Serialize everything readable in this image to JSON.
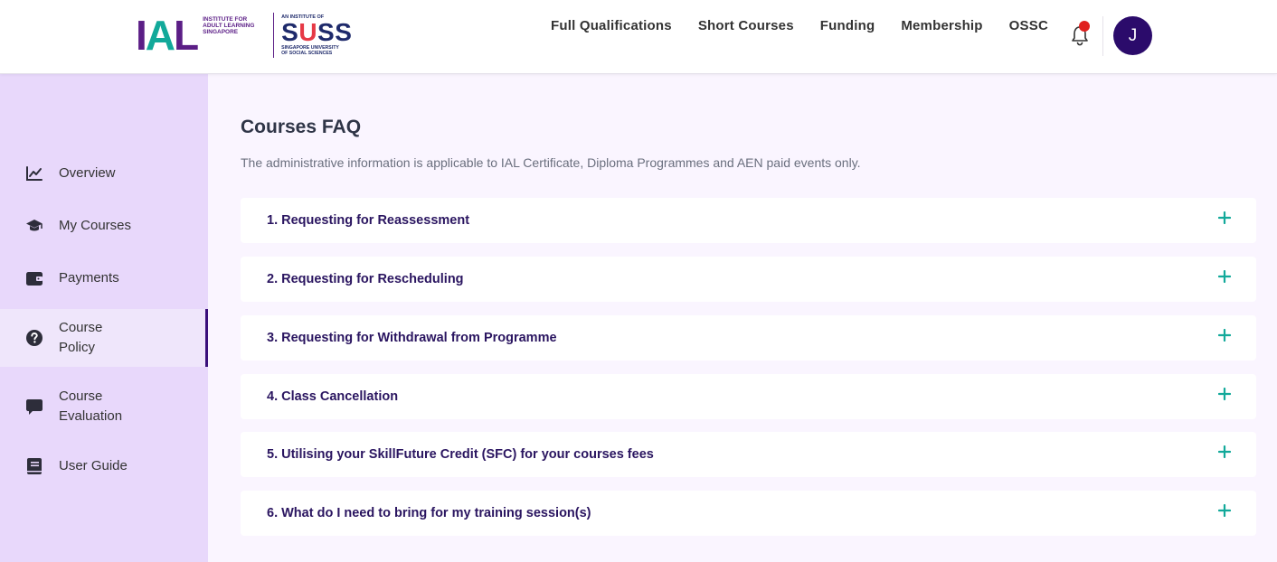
{
  "brand": {
    "ial_letters": [
      "I",
      "A",
      "L"
    ],
    "ial_subtitle": [
      "INSTITUTE FOR",
      "ADULT LEARNING",
      "SINGAPORE"
    ],
    "suss_pre": "AN INSTITUTE OF",
    "suss_name_parts": [
      "S",
      "U",
      "S",
      "S"
    ],
    "suss_subtitle": [
      "SINGAPORE UNIVERSITY",
      "OF SOCIAL SCIENCES"
    ],
    "colors": {
      "purple": "#5b1e86",
      "teal": "#12a99a",
      "navy": "#1e2a6b",
      "red": "#e63946"
    }
  },
  "nav": {
    "links": [
      "Full Qualifications",
      "Short Courses",
      "Funding",
      "Membership",
      "OSSC"
    ]
  },
  "header": {
    "bell_icon": "bell-icon",
    "notification_dot_color": "#e0201e",
    "avatar_initial": "J",
    "avatar_color": "#2b0b6b"
  },
  "sidebar": {
    "items": [
      {
        "label": "Overview",
        "icon": "chart-line-icon"
      },
      {
        "label": "My Courses",
        "icon": "graduation-cap-icon"
      },
      {
        "label": "Payments",
        "icon": "wallet-icon"
      },
      {
        "label": "Course Policy",
        "label_lines": [
          "Course",
          "Policy"
        ],
        "icon": "question-circle-icon",
        "active": true
      },
      {
        "label": "Course Evaluation",
        "label_lines": [
          "Course",
          "Evaluation"
        ],
        "icon": "comment-icon"
      },
      {
        "label": "User Guide",
        "icon": "book-icon"
      }
    ],
    "active_color": "#3a0f7a"
  },
  "main": {
    "title": "Courses FAQ",
    "description": "The administrative information is applicable to IAL Certificate, Diploma Programmes and AEN paid events only.",
    "faqs": [
      "1. Requesting for Reassessment",
      "2. Requesting for Rescheduling",
      "3. Requesting for Withdrawal from Programme",
      "4. Class Cancellation",
      "5. Utilising your SkillFuture Credit (SFC) for your courses fees",
      "6. What do I need to bring for my training session(s)"
    ],
    "plus_icon_color": "#12a99a"
  }
}
